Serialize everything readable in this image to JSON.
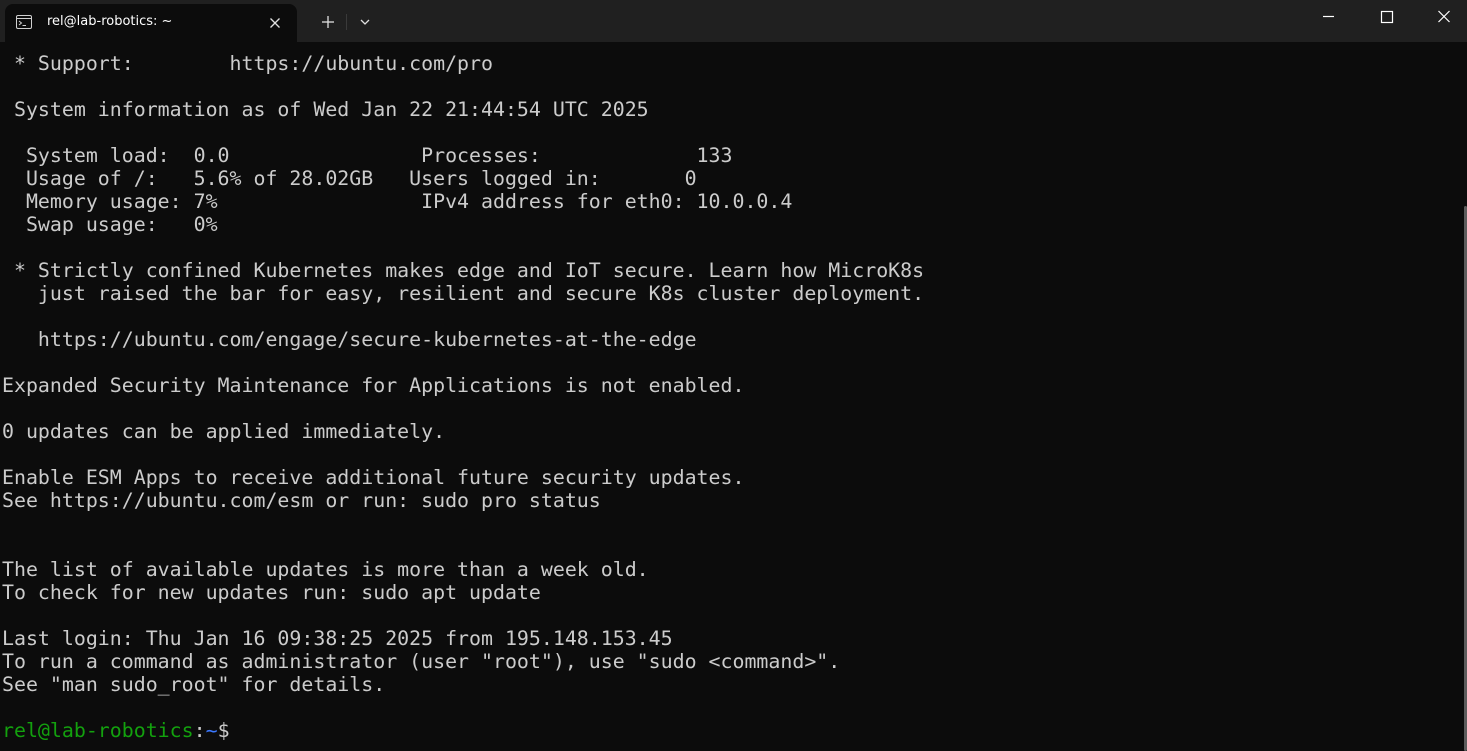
{
  "window": {
    "tab_title": "rel@lab-robotics: ~",
    "buttons": {
      "new_tab": "plus-icon",
      "dropdown": "chevron-down-icon",
      "minimize": "minimize-icon",
      "maximize": "maximize-icon",
      "close": "close-icon"
    }
  },
  "terminal": {
    "lines": [
      " * Support:        https://ubuntu.com/pro",
      "",
      " System information as of Wed Jan 22 21:44:54 UTC 2025",
      "",
      "  System load:  0.0                Processes:             133",
      "  Usage of /:   5.6% of 28.02GB   Users logged in:       0",
      "  Memory usage: 7%                 IPv4 address for eth0: 10.0.0.4",
      "  Swap usage:   0%",
      "",
      " * Strictly confined Kubernetes makes edge and IoT secure. Learn how MicroK8s",
      "   just raised the bar for easy, resilient and secure K8s cluster deployment.",
      "",
      "   https://ubuntu.com/engage/secure-kubernetes-at-the-edge",
      "",
      "Expanded Security Maintenance for Applications is not enabled.",
      "",
      "0 updates can be applied immediately.",
      "",
      "Enable ESM Apps to receive additional future security updates.",
      "See https://ubuntu.com/esm or run: sudo pro status",
      "",
      "",
      "The list of available updates is more than a week old.",
      "To check for new updates run: sudo apt update",
      "",
      "Last login: Thu Jan 16 09:38:25 2025 from 195.148.153.45",
      "To run a command as administrator (user \"root\"), use \"sudo <command>\".",
      "See \"man sudo_root\" for details.",
      ""
    ],
    "prompt": {
      "user_host": "rel@lab-robotics",
      "separator": ":",
      "path": "~",
      "symbol": "$"
    }
  },
  "colors": {
    "background": "#0c0c0c",
    "titlebar": "#202020",
    "text": "#cccccc",
    "prompt_user": "#13a10e",
    "prompt_path": "#3b78ff"
  }
}
